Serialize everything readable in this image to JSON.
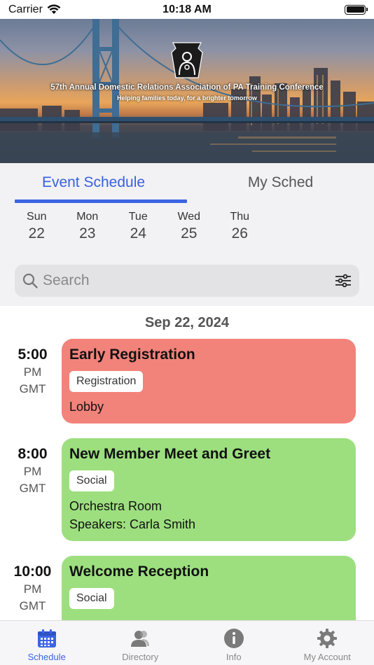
{
  "status_bar": {
    "carrier": "Carrier",
    "time": "10:18 AM"
  },
  "banner": {
    "title": "57th Annual Domestic Relations Association of PA Training Conference",
    "subtitle": "Helping families today, for a brighter tomorrow"
  },
  "tabs": [
    {
      "label": "Event Schedule",
      "active": true
    },
    {
      "label": "My Sched",
      "active": false
    }
  ],
  "days": [
    {
      "name": "Sun",
      "num": "22"
    },
    {
      "name": "Mon",
      "num": "23"
    },
    {
      "name": "Tue",
      "num": "24"
    },
    {
      "name": "Wed",
      "num": "25"
    },
    {
      "name": "Thu",
      "num": "26"
    }
  ],
  "search": {
    "placeholder": "Search"
  },
  "schedule": {
    "date_header": "Sep 22, 2024",
    "events": [
      {
        "time": "5:00",
        "ampm": "PM",
        "tz": "GMT",
        "title": "Early Registration",
        "category": "Registration",
        "location": "Lobby",
        "speakers": "",
        "color": "#f2837b"
      },
      {
        "time": "8:00",
        "ampm": "PM",
        "tz": "GMT",
        "title": "New Member Meet and Greet",
        "category": "Social",
        "location": "Orchestra Room",
        "speakers": "Speakers: Carla Smith",
        "color": "#9ddf7f"
      },
      {
        "time": "10:00",
        "ampm": "PM",
        "tz": "GMT",
        "title": "Welcome Reception",
        "category": "Social",
        "location": "",
        "speakers": "",
        "color": "#9ddf7f"
      }
    ]
  },
  "bottom_nav": [
    {
      "label": "Schedule",
      "icon": "calendar-icon",
      "active": true
    },
    {
      "label": "Directory",
      "icon": "person-icon",
      "active": false
    },
    {
      "label": "Info",
      "icon": "info-icon",
      "active": false
    },
    {
      "label": "My Account",
      "icon": "gear-icon",
      "active": false
    }
  ],
  "colors": {
    "accent": "#3b64e4",
    "registration": "#f2837b",
    "social": "#9ddf7f"
  }
}
